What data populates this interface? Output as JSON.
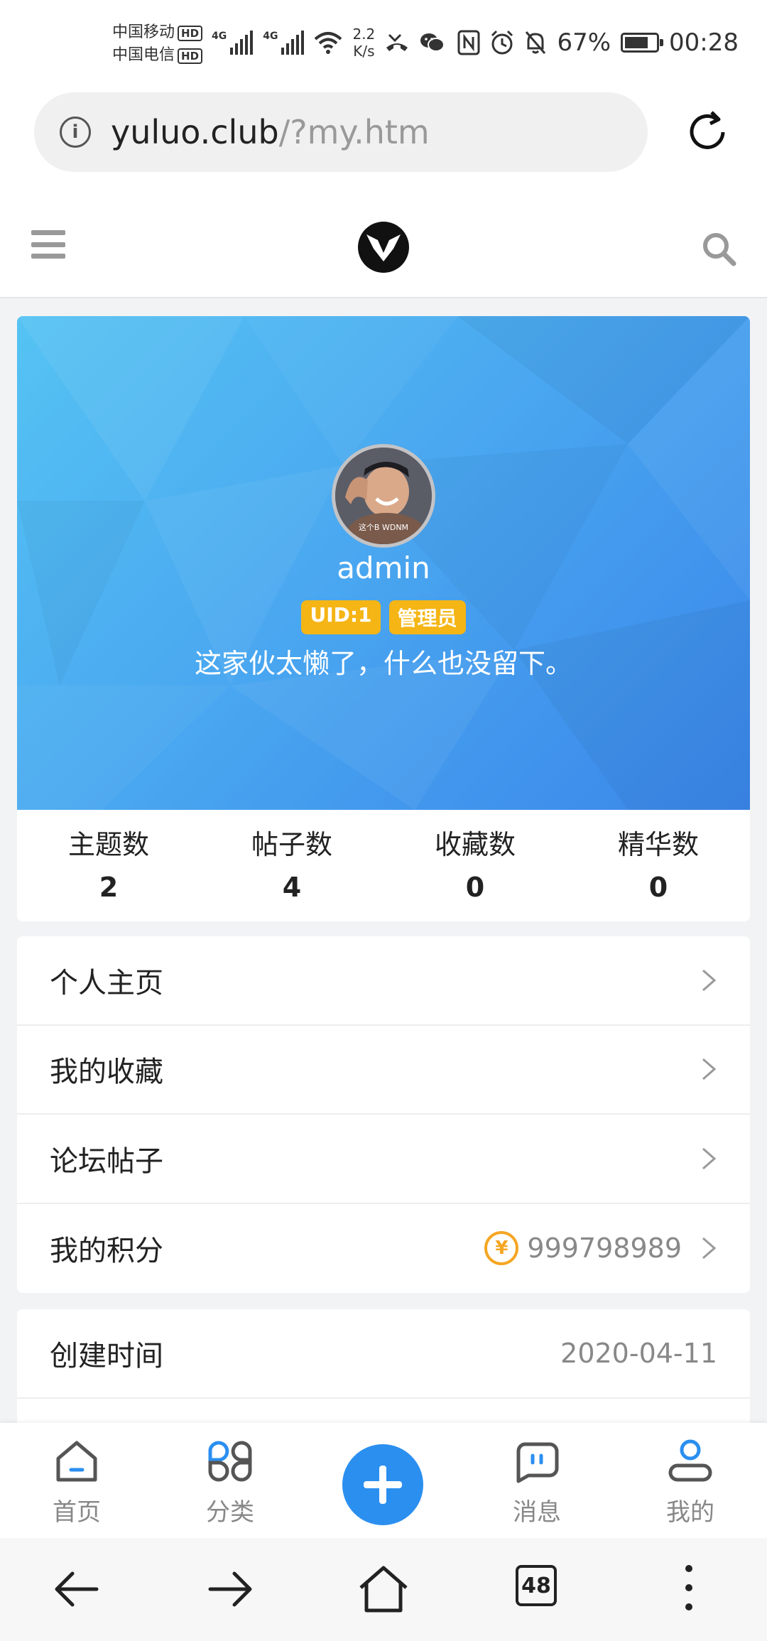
{
  "status_bar": {
    "carrier1": "中国移动",
    "carrier2": "中国电信",
    "hd_label": "HD",
    "net_type": "4G",
    "speed_value": "2.2",
    "speed_unit": "K/s",
    "battery_percent": "67%",
    "battery_level": 0.67,
    "time": "00:28",
    "icons": [
      "signal-icon",
      "wifi-icon",
      "missed-call-icon",
      "wechat-icon",
      "nfc-icon",
      "alarm-icon",
      "mute-icon",
      "battery-icon"
    ]
  },
  "browser": {
    "url_host": "yuluo.club",
    "url_path": "/?my.htm",
    "info_icon_label": "i",
    "tabs_count": "48"
  },
  "profile": {
    "username": "admin",
    "uid_badge": "UID:1",
    "role_badge": "管理员",
    "bio": "这家伙太懒了，什么也没留下。",
    "avatar_caption": "这个B WDNM"
  },
  "stats": [
    {
      "label": "主题数",
      "value": "2"
    },
    {
      "label": "帖子数",
      "value": "4"
    },
    {
      "label": "收藏数",
      "value": "0"
    },
    {
      "label": "精华数",
      "value": "0"
    }
  ],
  "menu": [
    {
      "label": "个人主页"
    },
    {
      "label": "我的收藏"
    },
    {
      "label": "论坛帖子"
    },
    {
      "label": "我的积分",
      "coin_symbol": "¥",
      "value": "999798989"
    }
  ],
  "info": [
    {
      "label": "创建时间",
      "value": "2020-04-11"
    }
  ],
  "tabbar": [
    {
      "label": "首页",
      "icon": "home-icon"
    },
    {
      "label": "分类",
      "icon": "category-icon"
    },
    {
      "label": "消息",
      "icon": "message-icon"
    },
    {
      "label": "我的",
      "icon": "user-icon"
    }
  ],
  "colors": {
    "accent": "#2b8ff0",
    "banner_start": "#55c3f3",
    "banner_end": "#3a86ea",
    "badge": "#f5b515",
    "coin": "#f5a623"
  }
}
